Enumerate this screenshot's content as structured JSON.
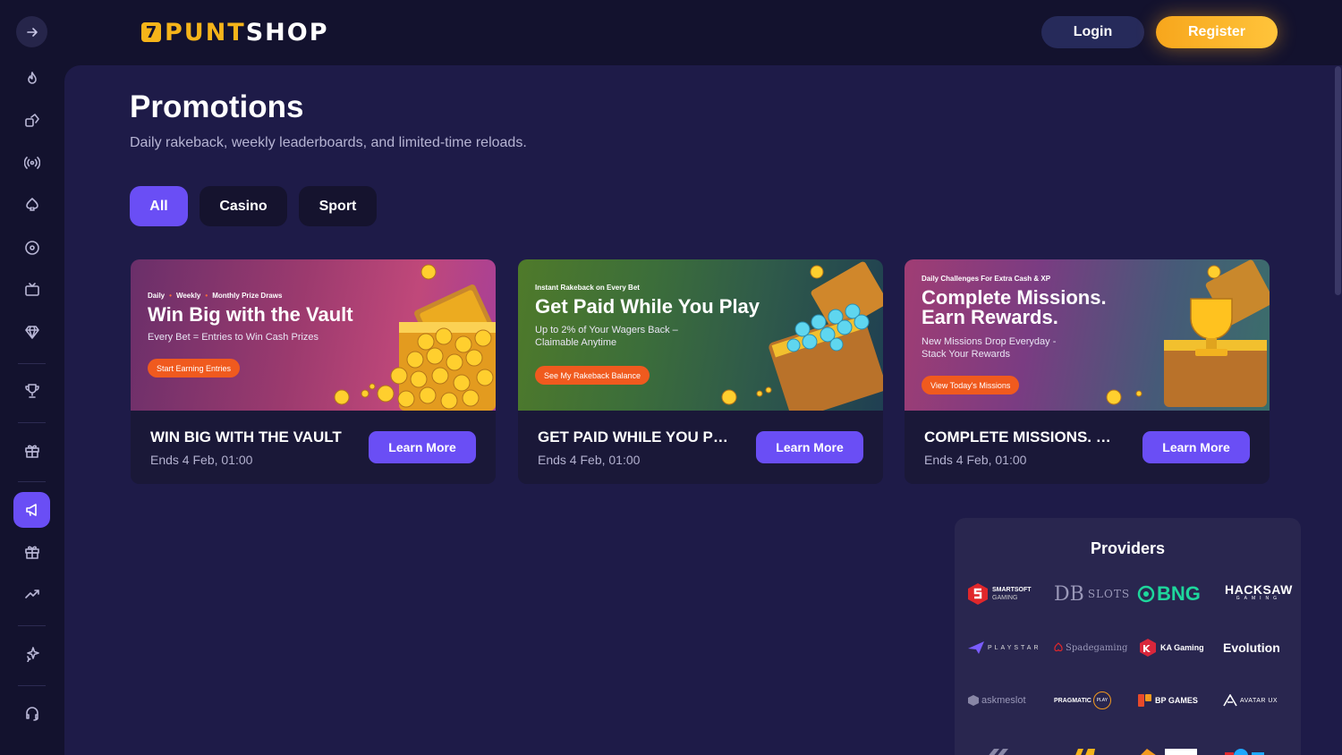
{
  "brand": {
    "logo_part1": "PUNT",
    "logo_part2": "SHOP",
    "logo_mark": "7"
  },
  "header": {
    "login_label": "Login",
    "register_label": "Register"
  },
  "sidebar": {
    "items": [
      {
        "icon": "fire-icon"
      },
      {
        "icon": "dice-icon"
      },
      {
        "icon": "live-broadcast-icon"
      },
      {
        "icon": "spade-icon"
      },
      {
        "icon": "roulette-icon"
      },
      {
        "icon": "tv-icon"
      },
      {
        "icon": "diamond-icon"
      },
      {
        "icon": "trophy-icon"
      },
      {
        "icon": "gift-icon"
      },
      {
        "icon": "megaphone-icon",
        "active": true
      },
      {
        "icon": "gift-box-icon"
      },
      {
        "icon": "trend-icon"
      },
      {
        "icon": "sparkle-icon"
      },
      {
        "icon": "headset-icon"
      }
    ]
  },
  "page": {
    "title": "Promotions",
    "subtitle": "Daily rakeback, weekly leaderboards, and limited-time reloads."
  },
  "tabs": [
    {
      "label": "All",
      "active": true
    },
    {
      "label": "Casino",
      "active": false
    },
    {
      "label": "Sport",
      "active": false
    }
  ],
  "promotions": [
    {
      "banner_tags": [
        "Daily",
        "Weekly",
        "Monthly Prize Draws"
      ],
      "banner_heading": "Win Big with the Vault",
      "banner_desc": "Every Bet = Entries to Win Cash Prizes",
      "banner_cta": "Start Earning Entries",
      "title": "WIN BIG WITH THE VAULT",
      "ends": "Ends 4 Feb, 01:00",
      "button": "Learn More"
    },
    {
      "banner_tags": [
        "Instant Rakeback on Every Bet"
      ],
      "banner_heading": "Get Paid While You Play",
      "banner_desc": "Up to 2% of Your Wagers Back –\nClaimable Anytime",
      "banner_cta": "See My Rakeback Balance",
      "title": "GET PAID WHILE YOU PLAY",
      "ends": "Ends 4 Feb, 01:00",
      "button": "Learn More"
    },
    {
      "banner_tags": [
        "Daily Challenges For Extra Cash & XP"
      ],
      "banner_heading": "Complete Missions.\nEarn Rewards.",
      "banner_desc": "New Missions Drop Everyday -\nStack Your Rewards",
      "banner_cta": "View Today's Missions",
      "title": "COMPLETE MISSIONS. EARN REWARDS.",
      "ends": "Ends 4 Feb, 01:00",
      "button": "Learn More"
    }
  ],
  "providers": {
    "title": "Providers",
    "items": [
      {
        "name": "SMARTSOFT",
        "sub": "GAMING"
      },
      {
        "name": "DB",
        "sub": "SLOTS"
      },
      {
        "name": "BNG"
      },
      {
        "name": "HACKSAW",
        "sub": "GAMING"
      },
      {
        "name": "PLAYSTAR"
      },
      {
        "name": "Spadegaming"
      },
      {
        "name": "KA Gaming"
      },
      {
        "name": "Evolution"
      },
      {
        "name": "askmeslot"
      },
      {
        "name": "PRAGMATIC",
        "sub": "PLAY"
      },
      {
        "name": "BP GAMES"
      },
      {
        "name": "AVATAR UX"
      }
    ]
  },
  "colors": {
    "accent": "#6a4ef5",
    "brand_gold": "#f5b41a",
    "cta_orange": "#f05a1e",
    "background": "#13122e",
    "panel": "#1e1b48"
  }
}
